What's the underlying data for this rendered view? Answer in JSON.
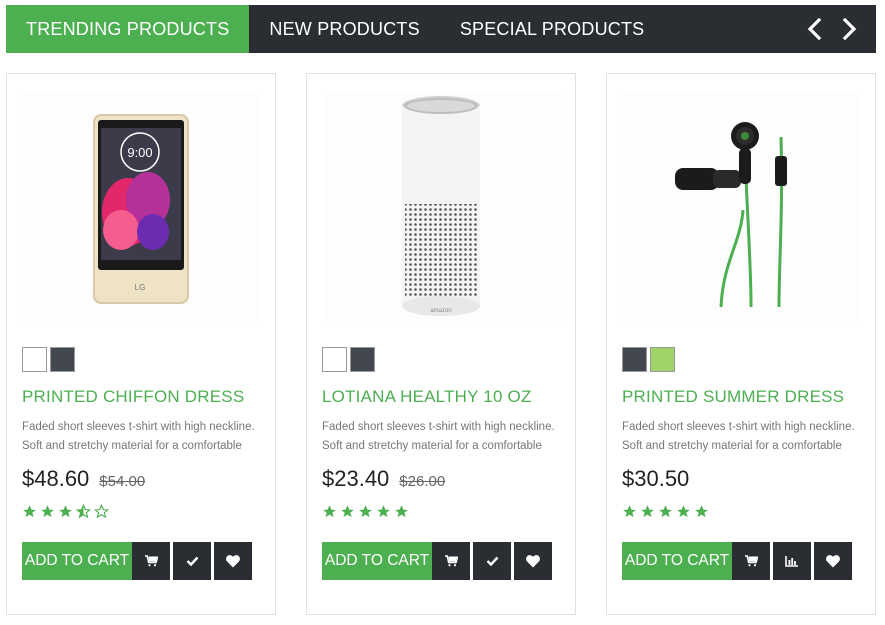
{
  "tabs": [
    {
      "label": "TRENDING PRODUCTS",
      "active": true
    },
    {
      "label": "NEW PRODUCTS",
      "active": false
    },
    {
      "label": "SPECIAL PRODUCTS",
      "active": false
    }
  ],
  "colors": {
    "accent": "#4caf50",
    "dark": "#2a2d32",
    "star": "#4caf50"
  },
  "products": [
    {
      "name": "PRINTED CHIFFON DRESS",
      "image": "smartphone",
      "swatches": [
        "#ffffff",
        "#434750"
      ],
      "description": "Faded short sleeves t-shirt with high neckline. Soft and stretchy material for a comfortable fit....",
      "price": "$48.60",
      "old_price": "$54.00",
      "rating": 3.5,
      "add_to_cart": "ADD TO CART",
      "action_icons": [
        "cart-icon",
        "check-icon",
        "heart-icon"
      ]
    },
    {
      "name": "LOTIANA HEALTHY 10 OZ",
      "image": "smart-speaker",
      "swatches": [
        "#ffffff",
        "#434750"
      ],
      "description": "Faded short sleeves t-shirt with high neckline. Soft and stretchy material for a comfortable fit....",
      "price": "$23.40",
      "old_price": "$26.00",
      "rating": 5,
      "add_to_cart": "ADD TO CART",
      "action_icons": [
        "cart-icon",
        "check-icon",
        "heart-icon"
      ]
    },
    {
      "name": "PRINTED SUMMER DRESS",
      "image": "earphones",
      "swatches": [
        "#434750",
        "#a0d468"
      ],
      "description": "Faded short sleeves t-shirt with high neckline. Soft and stretchy material for a comfortable fit....",
      "price": "$30.50",
      "old_price": "",
      "rating": 5,
      "add_to_cart": "ADD TO CART",
      "action_icons": [
        "cart-icon",
        "bar-chart-icon",
        "heart-icon"
      ]
    }
  ]
}
